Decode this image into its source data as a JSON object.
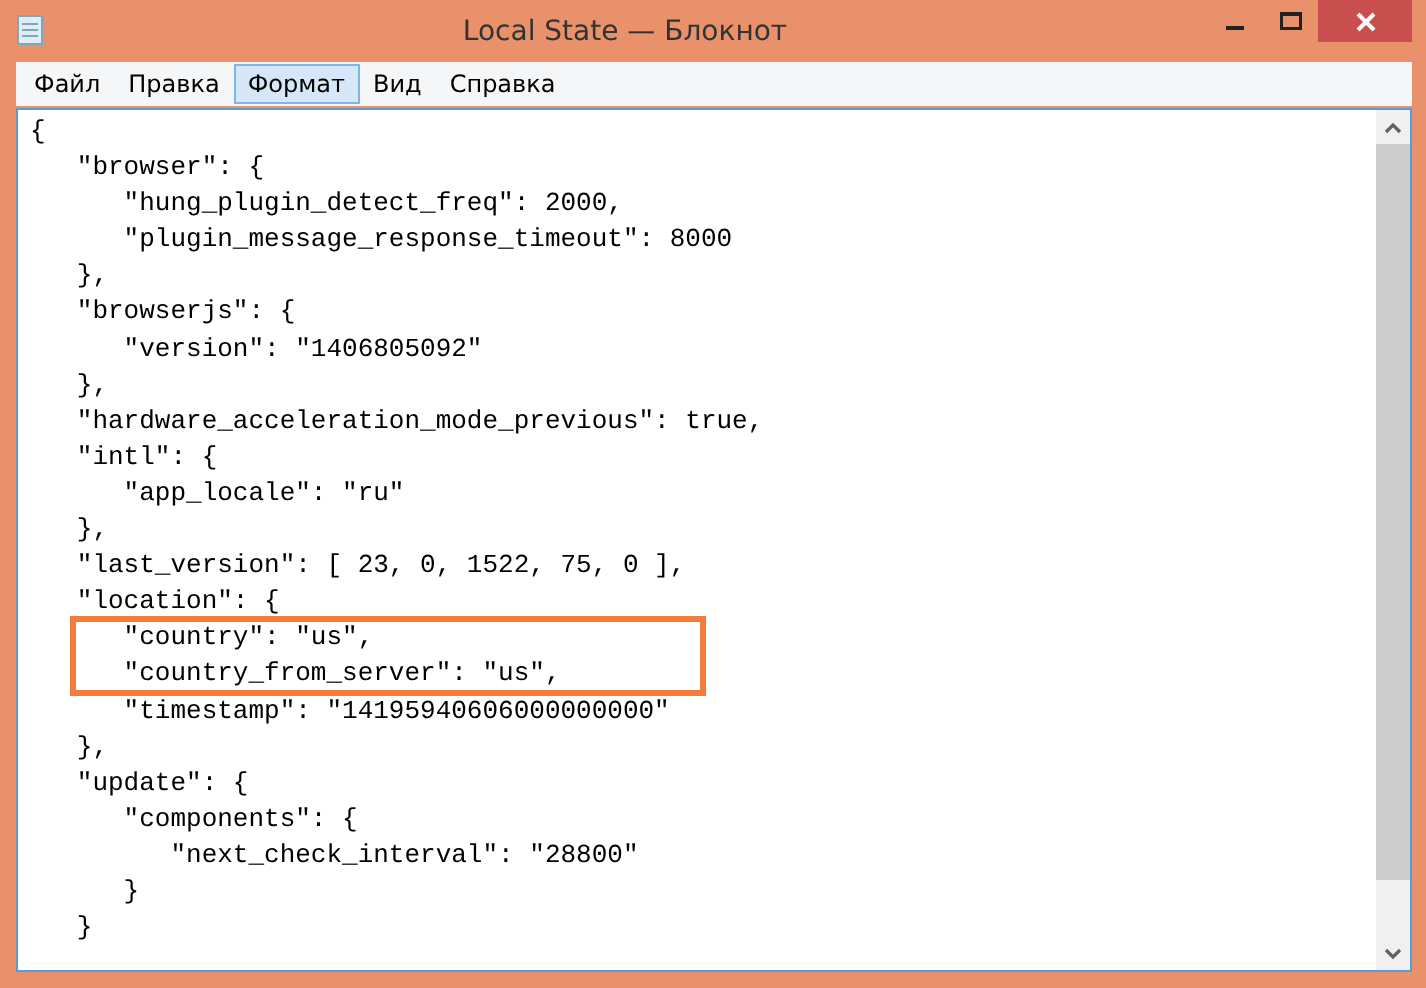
{
  "window": {
    "title": "Local State — Блокнот"
  },
  "menu": [
    {
      "label": "Файл",
      "selected": false
    },
    {
      "label": "Правка",
      "selected": false
    },
    {
      "label": "Формат",
      "selected": true
    },
    {
      "label": "Вид",
      "selected": false
    },
    {
      "label": "Справка",
      "selected": false
    }
  ],
  "editor": {
    "lines": [
      {
        "text": "{",
        "highlighted": false
      },
      {
        "text": "   \"browser\": {",
        "highlighted": false
      },
      {
        "text": "      \"hung_plugin_detect_freq\": 2000,",
        "highlighted": false
      },
      {
        "text": "      \"plugin_message_response_timeout\": 8000",
        "highlighted": false
      },
      {
        "text": "   },",
        "highlighted": false
      },
      {
        "text": "   \"browserjs\": {",
        "highlighted": false
      },
      {
        "text": "      \"version\": \"1406805092\"",
        "highlighted": false
      },
      {
        "text": "   },",
        "highlighted": false
      },
      {
        "text": "   \"hardware_acceleration_mode_previous\": true,",
        "highlighted": false
      },
      {
        "text": "   \"intl\": {",
        "highlighted": false
      },
      {
        "text": "      \"app_locale\": \"ru\"",
        "highlighted": false
      },
      {
        "text": "   },",
        "highlighted": false
      },
      {
        "text": "   \"last_version\": [ 23, 0, 1522, 75, 0 ],",
        "highlighted": false
      },
      {
        "text": "   \"location\": {",
        "highlighted": false
      },
      {
        "text": "      \"country\": \"us\",",
        "highlighted": true
      },
      {
        "text": "      \"country_from_server\": \"us\",",
        "highlighted": true
      },
      {
        "text": "      \"timestamp\": \"14195940606000000000\"",
        "highlighted": false
      },
      {
        "text": "   },",
        "highlighted": false
      },
      {
        "text": "   \"update\": {",
        "highlighted": false
      },
      {
        "text": "      \"components\": {",
        "highlighted": false
      },
      {
        "text": "         \"next_check_interval\": \"28800\"",
        "highlighted": false
      },
      {
        "text": "      }",
        "highlighted": false
      },
      {
        "text": "   }",
        "highlighted": false
      }
    ]
  }
}
